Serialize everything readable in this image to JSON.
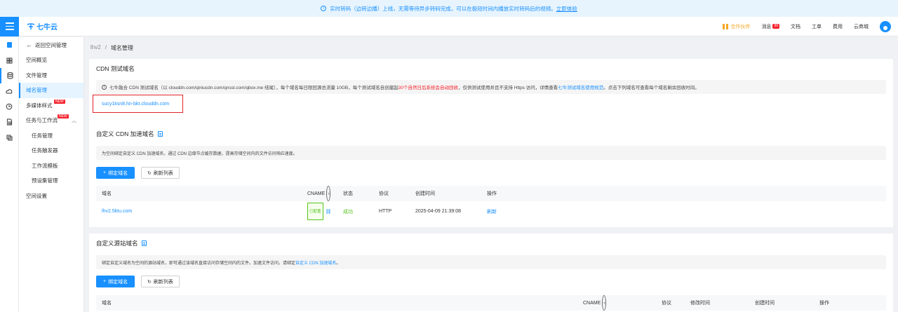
{
  "banner": {
    "text": "实时转码（边转边播）上线，无需等待异步转码完成，可以在极短时间内播放实时转码后的视频。",
    "link": "立即体验"
  },
  "header": {
    "logo_text": "七牛云",
    "promo": "合作伙伴",
    "messages": "消息",
    "messages_badge": "99",
    "docs": "文档",
    "tickets": "工单",
    "billing": "费用",
    "mall": "云商城"
  },
  "sidebar": {
    "back": "返回空间管理",
    "items": [
      {
        "label": "空间概览"
      },
      {
        "label": "文件管理"
      },
      {
        "label": "域名管理"
      },
      {
        "label": "多媒体样式",
        "tag": "NEW"
      },
      {
        "label": "任务与工作流",
        "tag": "NEW"
      },
      {
        "label": "任务管理"
      },
      {
        "label": "任务触发器"
      },
      {
        "label": "工作流模板"
      },
      {
        "label": "预设集管理"
      },
      {
        "label": "空间设置"
      }
    ]
  },
  "breadcrumb": {
    "bucket": "lhv2",
    "sep": "/",
    "page": "域名管理"
  },
  "cdn_test": {
    "title": "CDN 测试域名",
    "notice_pre": "七牛融合 CDN 测试域名（以 clouddn.com/qiniucdn.com/qnssl.com/qbox.me 结尾），每个域名每日限回源总流量 10GB，每个测试域名自创建起",
    "notice_red": "30个自然日后系统会自动回收",
    "notice_mid": "，仅供测试使用并且不支持 Https 访问，详情查看",
    "notice_link": "七牛测试域名使用规范",
    "notice_post": "。点击下列域名可查看每个域名剩余回收时间。",
    "domain": "sucy1ksn8.hn-bkt.clouddn.com"
  },
  "custom_cdn": {
    "title": "自定义 CDN 加速域名",
    "desc": "为空间绑定自定义 CDN 加速域名，通过 CDN 边缘节点缓存数据，提高存储空间内的文件访问响应速度。",
    "bind_btn": "绑定域名",
    "refresh_btn": "刷新列表",
    "columns": {
      "domain": "域名",
      "cname": "CNAME",
      "status": "状态",
      "protocol": "协议",
      "created": "创建时间",
      "action": "操作"
    },
    "rows": [
      {
        "domain": "lhv2.5ktu.com",
        "cname_tag": "已配置",
        "status": "成功",
        "protocol": "HTTP",
        "created": "2025-04-09 21:39:08",
        "action": "刷新"
      }
    ]
  },
  "custom_source": {
    "title": "自定义源站域名",
    "desc_pre": "绑定自定义域名为空间的源站域名，即可通过该域名直接访问存储空间内的文件。加速文件访问，请绑定",
    "desc_link": "自定义 CDN 加速域名",
    "desc_post": "。",
    "bind_btn": "绑定域名",
    "refresh_btn": "刷新列表",
    "columns": {
      "domain": "域名",
      "cname": "CNAME",
      "protocol": "协议",
      "modified": "修改时间",
      "created": "创建时间",
      "action": "操作"
    }
  }
}
